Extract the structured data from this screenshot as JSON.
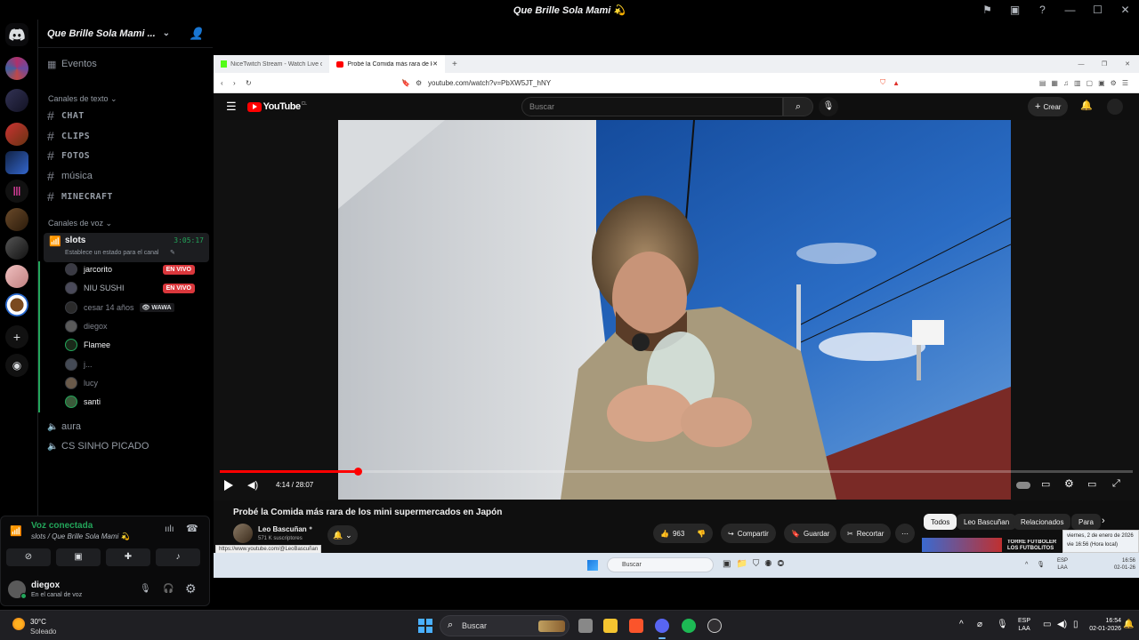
{
  "window": {
    "title": "Que Brille Sola Mami 💫"
  },
  "server": {
    "name": "Que Brille Sola Mami ...",
    "events_label": "Eventos",
    "text_category": "Canales de texto",
    "voice_category": "Canales de voz",
    "text_channels": [
      "CHAT",
      "CLIPS",
      "FOTOS",
      "música",
      "MINECRAFT"
    ],
    "active_voice": {
      "name": "slots",
      "timer": "3:05:17",
      "status_hint": "Establece un estado para el canal"
    },
    "members": [
      {
        "name": "jarcorito",
        "live": true,
        "bright": true
      },
      {
        "name": "NIU SUSHI",
        "live": true,
        "bright": false
      },
      {
        "name": "cesar 14 años",
        "live": false,
        "tag": "WAWA",
        "bright": false
      },
      {
        "name": "diegox",
        "live": false,
        "bright": false
      },
      {
        "name": "Flamee",
        "live": false,
        "bright": true
      },
      {
        "name": "j...",
        "live": false,
        "bright": false
      },
      {
        "name": "lucy",
        "live": false,
        "bright": false
      },
      {
        "name": "santi",
        "live": false,
        "bright": true
      }
    ],
    "live_badge": "EN VIVO",
    "other_voice": [
      "aura",
      "CS SINHO PICADO"
    ]
  },
  "voice_panel": {
    "status": "Voz conectada",
    "location": "slots / Que Brille Sola Mami 💫",
    "user_name": "diegox",
    "user_status": "En el canal de voz"
  },
  "browser": {
    "tabs": [
      "NiceTwitch Stream - Watch Live on K",
      "Probé la Comida más rara de los"
    ],
    "url": "youtube.com/watch?v=PbXW5JT_hNY",
    "status_url": "https://www.youtube.com/@LeoBascuñan"
  },
  "youtube": {
    "logo": "YouTube",
    "region": "CL",
    "search_placeholder": "Buscar",
    "create_label": "Crear",
    "time": "4:14 / 28:07",
    "progress": 0.151,
    "video_title": "Probé la Comida más rara de los mini supermercados en Japón",
    "channel": "Leo Bascuñan",
    "subscribers": "571 K suscriptores",
    "likes": "963",
    "share": "Compartir",
    "save": "Guardar",
    "clip": "Recortar",
    "chips": [
      "Todos",
      "Leo Bascuñan",
      "Relacionados",
      "Para"
    ],
    "suggestion_text": "TORRE FUTBOLER LOS FUTBOLITOS",
    "tooltip_date": "viernes, 2 de enero de 2026",
    "tooltip_time": "vie 16:56 (Hora local)"
  },
  "inner_taskbar": {
    "search": "Buscar",
    "lang": "ESP",
    "lang2": "LAA",
    "time": "16:56",
    "date": "02-01-26"
  },
  "taskbar": {
    "temp": "30°C",
    "weather": "Soleado",
    "search": "Buscar",
    "lang": "ESP",
    "lang2": "LAA",
    "time": "16:54",
    "date": "02-01-2026"
  },
  "colors": {
    "discord_green": "#23a55a",
    "live_red": "#da373c",
    "yt_red": "#ff0000"
  }
}
